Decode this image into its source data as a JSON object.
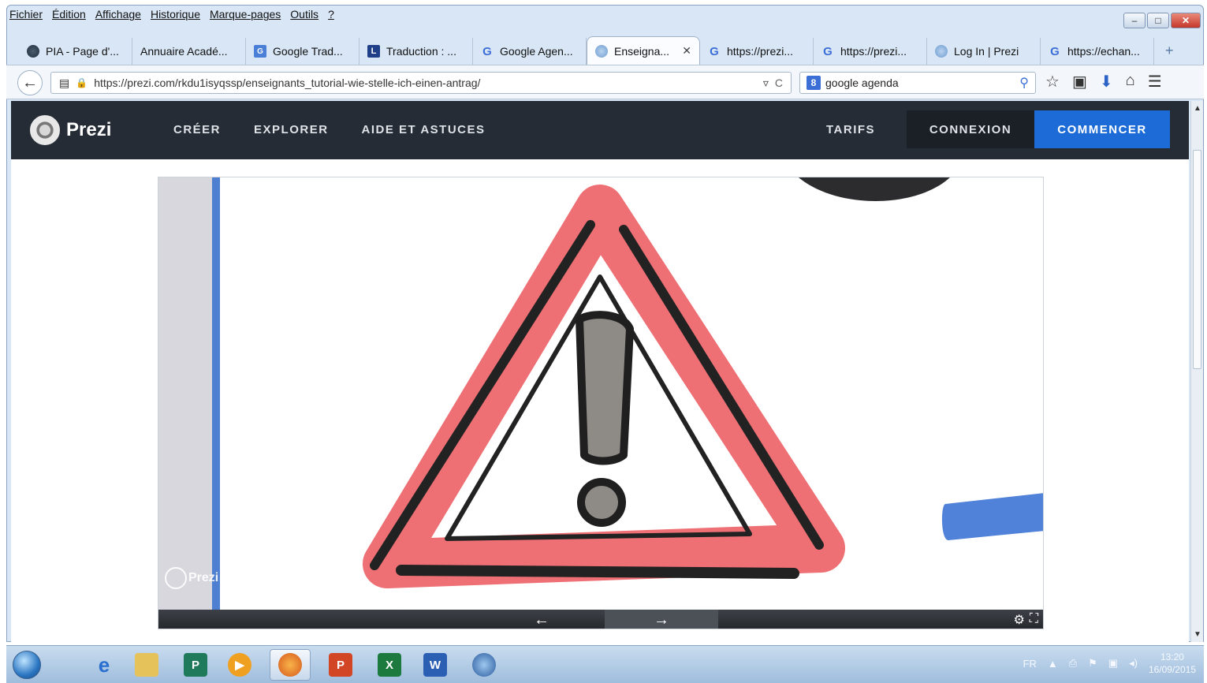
{
  "menubar": [
    "Fichier",
    "Édition",
    "Affichage",
    "Historique",
    "Marque-pages",
    "Outils",
    "?"
  ],
  "window_controls": {
    "minimize": "–",
    "maximize": "□",
    "close": "✕"
  },
  "tabs": [
    {
      "label": "PIA - Page d'...",
      "favicon": "earth-icon",
      "active": false
    },
    {
      "label": "Annuaire Acadé...",
      "favicon": "none",
      "active": false
    },
    {
      "label": "Google Trad...",
      "favicon": "google-translate-icon",
      "active": false
    },
    {
      "label": "Traduction : ...",
      "favicon": "larousse-icon",
      "active": false
    },
    {
      "label": "Google Agen...",
      "favicon": "google-icon",
      "active": false
    },
    {
      "label": "Enseigna...",
      "favicon": "prezi-icon",
      "active": true
    },
    {
      "label": "https://prezi...",
      "favicon": "google-icon",
      "active": false
    },
    {
      "label": "https://prezi...",
      "favicon": "google-icon",
      "active": false
    },
    {
      "label": "Log In | Prezi",
      "favicon": "prezi-icon",
      "active": false
    },
    {
      "label": "https://echan...",
      "favicon": "google-icon",
      "active": false
    }
  ],
  "navbar": {
    "url": "https://prezi.com/rkdu1isyqssp/enseignants_tutorial-wie-stelle-ich-einen-antrag/",
    "search_value": "google agenda",
    "search_engine_icon": "g-icon"
  },
  "prezi_header": {
    "logo_text": "Prezi",
    "nav": [
      "CRÉER",
      "EXPLORER",
      "AIDE ET ASTUCES"
    ],
    "tarifs": "TARIFS",
    "connexion": "CONNEXION",
    "commencer": "COMMENCER"
  },
  "viewer": {
    "watermark": "Prezi",
    "prev_icon": "arrow-left-icon",
    "next_icon": "arrow-right-icon",
    "settings_icon": "gear-icon",
    "fullscreen_icon": "fullscreen-icon"
  },
  "taskbar": {
    "language": "FR",
    "time": "13:20",
    "date": "16/09/2015",
    "apps": [
      "internet-explorer-icon",
      "file-explorer-icon",
      "publisher-icon",
      "media-player-icon",
      "firefox-icon",
      "powerpoint-icon",
      "excel-icon",
      "word-icon",
      "thunderbird-icon"
    ]
  },
  "colors": {
    "prezi_header": "#252c35",
    "commencer": "#1c6bd6",
    "warning_red": "#ee6f74",
    "accent_blue": "#4f7fd0"
  }
}
